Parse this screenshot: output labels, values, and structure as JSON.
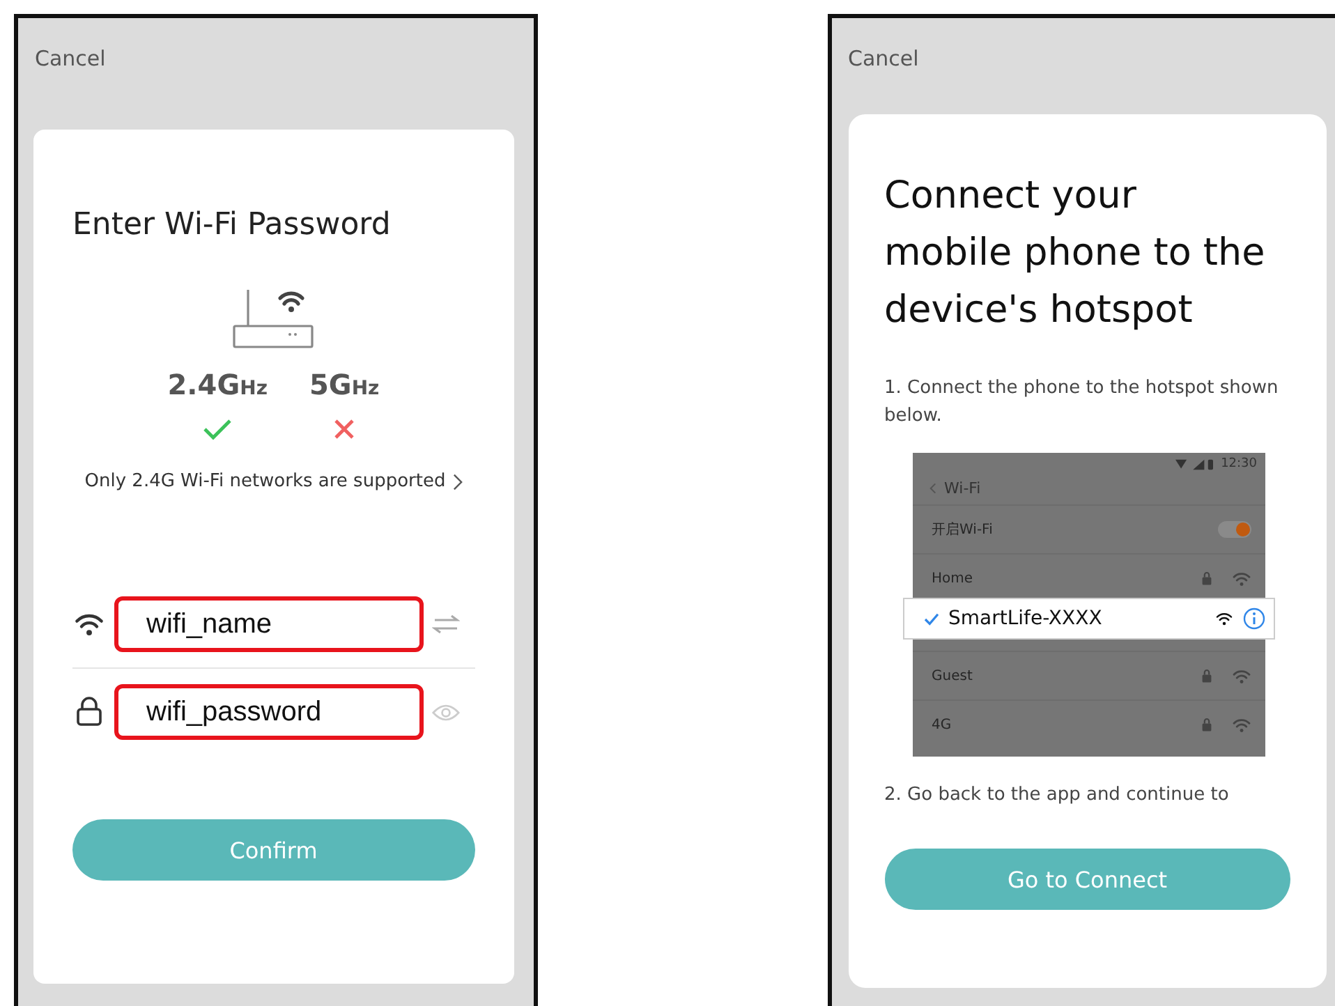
{
  "left_screen": {
    "cancel": "Cancel",
    "title": "Enter Wi-Fi Password",
    "bands": [
      {
        "label": "2.4G",
        "unit": "Hz",
        "supported": true
      },
      {
        "label": "5G",
        "unit": "Hz",
        "supported": false
      }
    ],
    "note": "Only 2.4G Wi-Fi networks are supported",
    "fields": [
      {
        "kind": "ssid",
        "value": "wifi_name",
        "highlighted": true
      },
      {
        "kind": "password",
        "value": "wifi_password",
        "highlighted": true
      }
    ],
    "confirm_button": "Confirm"
  },
  "right_screen": {
    "cancel": "Cancel",
    "title": "Connect your mobile phone to the device's hotspot",
    "step_1": "1. Connect the phone to the hotspot shown below.",
    "screenshot": {
      "time": "12:30",
      "header": "Wi-Fi",
      "rows": [
        {
          "kind": "toggle",
          "label": "开启Wi-Fi",
          "on": true
        },
        {
          "kind": "network",
          "label": "Home"
        },
        {
          "kind": "gap"
        },
        {
          "kind": "network",
          "label": "Guest"
        },
        {
          "kind": "network",
          "label": "4G"
        }
      ],
      "popup": {
        "network": "SmartLife-XXXX",
        "checked": true
      }
    },
    "step_2": "2. Go back to the app and continue to",
    "connect_button": "Go to Connect"
  }
}
